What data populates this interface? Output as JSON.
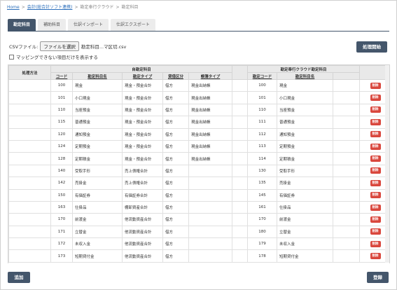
{
  "breadcrumb": {
    "home": "Home",
    "link": "会計(総合計ソフト連携)",
    "current1": "勘定奉行クラウド",
    "current2": "勘定科目"
  },
  "tabs": [
    {
      "label": "勘定科目",
      "active": true
    },
    {
      "label": "補助科目",
      "active": false
    },
    {
      "label": "仕訳インポート",
      "active": false
    },
    {
      "label": "仕訳エクスポート",
      "active": false
    }
  ],
  "csv": {
    "label": "CSVファイル:",
    "button": "ファイルを選択",
    "filename": "勘定科目...マ区切.csv"
  },
  "process_button": "処理開始",
  "checkbox_label": "マッピングできない項目だけを表示する",
  "table": {
    "group_left": "自勘定科目",
    "group_right": "勘定奉行クラウド勘定科目",
    "headers": {
      "method": "処理方法",
      "code": "コード",
      "name": "勘定科目名",
      "type": "勘定タイプ",
      "balance": "貸借区分",
      "aux_type": "帳簿タイプ",
      "r_code": "勘定コード",
      "r_name": "勘定科目名"
    },
    "delete_label": "削除",
    "rows": [
      {
        "code": "100",
        "name": "現金",
        "type": "現金・預金合計",
        "balance": "借方",
        "aux": "現金出納帳",
        "r_code": "100",
        "r_name": "現金"
      },
      {
        "code": "101",
        "name": "小口現金",
        "type": "現金・預金合計",
        "balance": "借方",
        "aux": "現金出納帳",
        "r_code": "101",
        "r_name": "小口現金"
      },
      {
        "code": "110",
        "name": "当座預金",
        "type": "現金・預金合計",
        "balance": "借方",
        "aux": "現金出納帳",
        "r_code": "110",
        "r_name": "当座預金"
      },
      {
        "code": "115",
        "name": "普通預金",
        "type": "現金・預金合計",
        "balance": "借方",
        "aux": "現金出納帳",
        "r_code": "111",
        "r_name": "普通預金"
      },
      {
        "code": "120",
        "name": "通知預金",
        "type": "現金・預金合計",
        "balance": "借方",
        "aux": "現金出納帳",
        "r_code": "112",
        "r_name": "通知預金"
      },
      {
        "code": "124",
        "name": "定期預金",
        "type": "現金・預金合計",
        "balance": "借方",
        "aux": "現金出納帳",
        "r_code": "113",
        "r_name": "定期預金"
      },
      {
        "code": "128",
        "name": "定期積金",
        "type": "現金・預金合計",
        "balance": "借方",
        "aux": "現金出納帳",
        "r_code": "114",
        "r_name": "定期積金"
      },
      {
        "code": "140",
        "name": "受取手形",
        "type": "売上債権合計",
        "balance": "借方",
        "aux": "",
        "r_code": "130",
        "r_name": "受取手形"
      },
      {
        "code": "142",
        "name": "売掛金",
        "type": "売上債権合計",
        "balance": "借方",
        "aux": "",
        "r_code": "135",
        "r_name": "売掛金"
      },
      {
        "code": "150",
        "name": "有価証券",
        "type": "有価証券合計",
        "balance": "借方",
        "aux": "",
        "r_code": "145",
        "r_name": "有価証券"
      },
      {
        "code": "163",
        "name": "仕掛品",
        "type": "棚卸資産合計",
        "balance": "借方",
        "aux": "",
        "r_code": "161",
        "r_name": "仕掛品"
      },
      {
        "code": "170",
        "name": "前渡金",
        "type": "他流動資産合計",
        "balance": "借方",
        "aux": "",
        "r_code": "170",
        "r_name": "前渡金"
      },
      {
        "code": "171",
        "name": "立替金",
        "type": "他流動資産合計",
        "balance": "借方",
        "aux": "",
        "r_code": "180",
        "r_name": "立替金"
      },
      {
        "code": "172",
        "name": "未収入金",
        "type": "他流動資産合計",
        "balance": "借方",
        "aux": "",
        "r_code": "179",
        "r_name": "未収入金"
      },
      {
        "code": "173",
        "name": "短期貸付金",
        "type": "他流動資産合計",
        "balance": "借方",
        "aux": "",
        "r_code": "178",
        "r_name": "短期貸付金"
      }
    ]
  },
  "add_button": "追加",
  "register_button": "登録"
}
